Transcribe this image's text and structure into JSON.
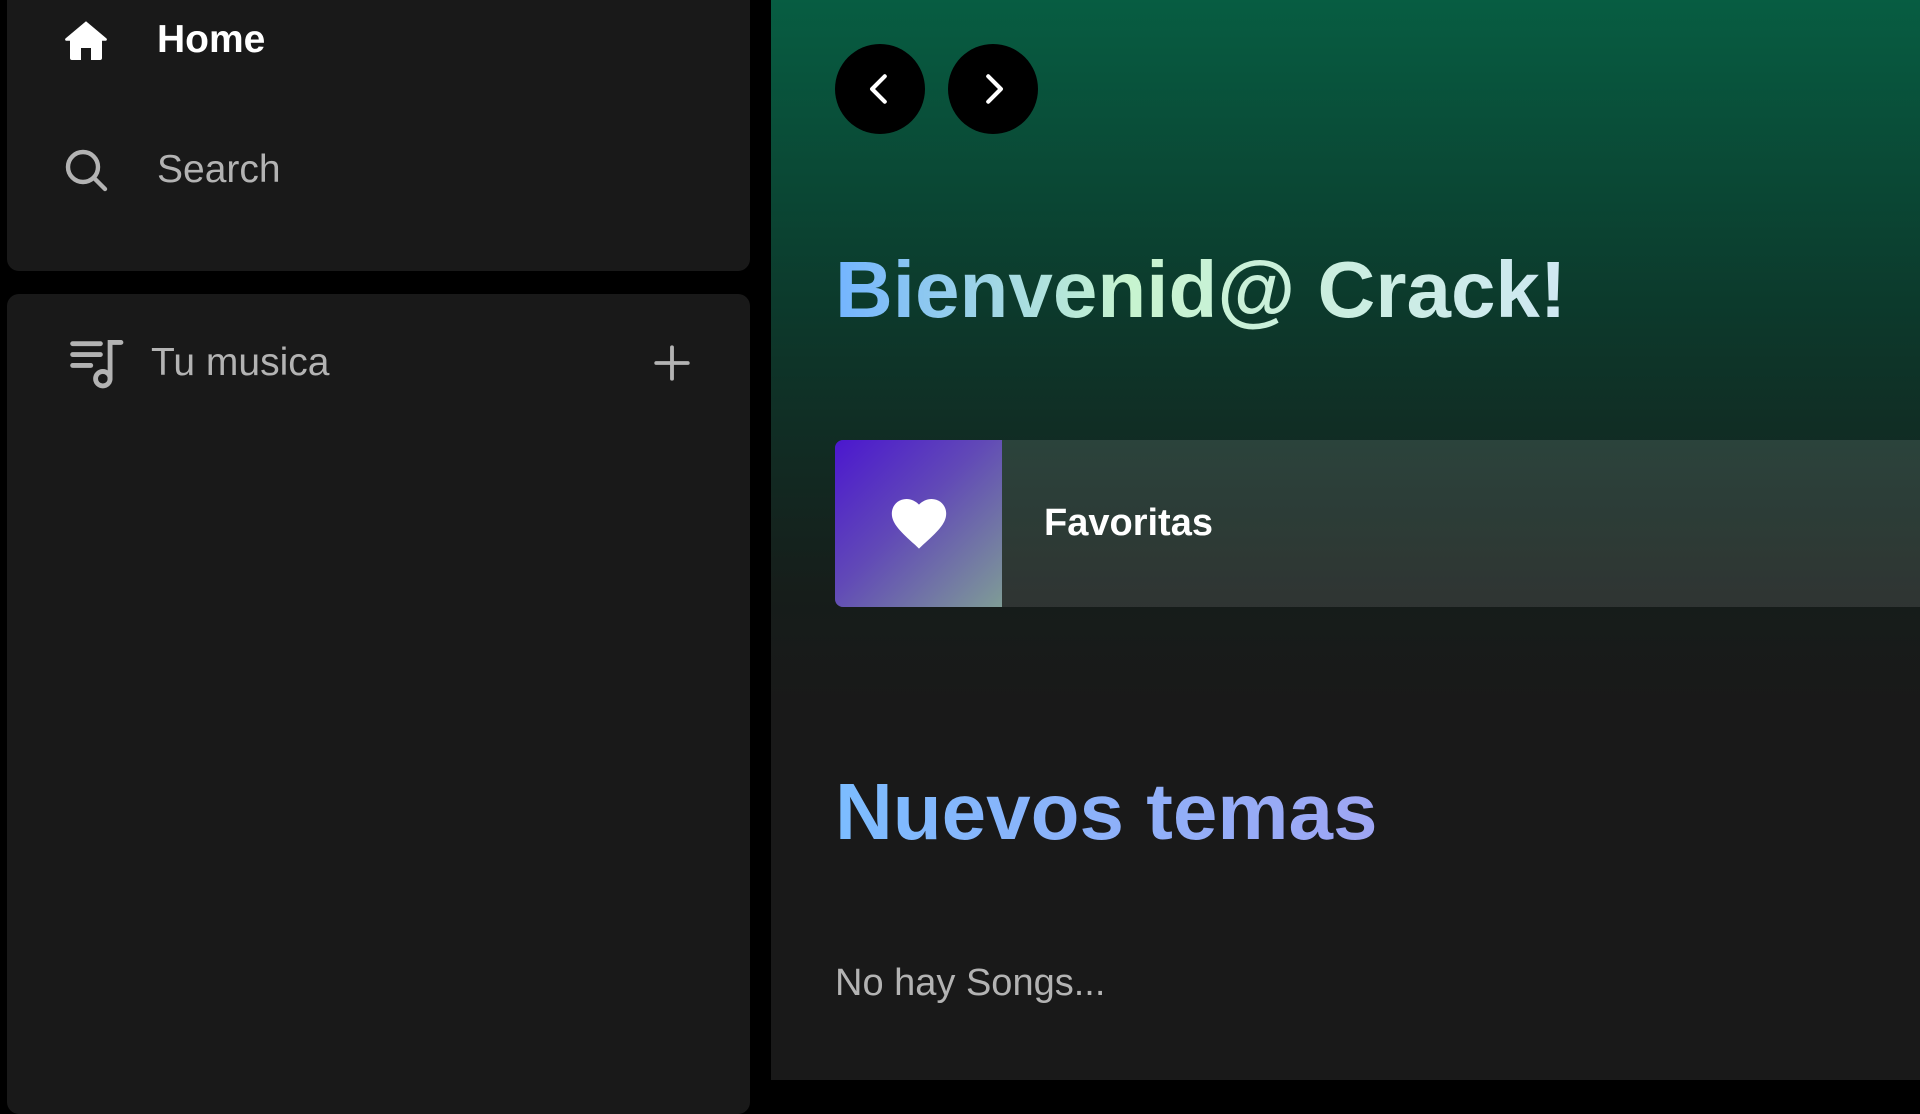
{
  "sidebar": {
    "nav": {
      "home_label": "Home",
      "search_label": "Search"
    },
    "library": {
      "title": "Tu musica",
      "add_icon": "plus-icon",
      "library_icon": "playlist-music-icon"
    }
  },
  "main": {
    "welcome_title": "Bienvenid@ Crack!",
    "favorites": {
      "label": "Favoritas",
      "icon": "heart-icon"
    },
    "new_songs_title": "Nuevos temas",
    "empty_message": "No hay Songs..."
  },
  "colors": {
    "accent_green": "#075d42",
    "panel": "#191919",
    "favorites_cover_start": "#4b17cf"
  }
}
